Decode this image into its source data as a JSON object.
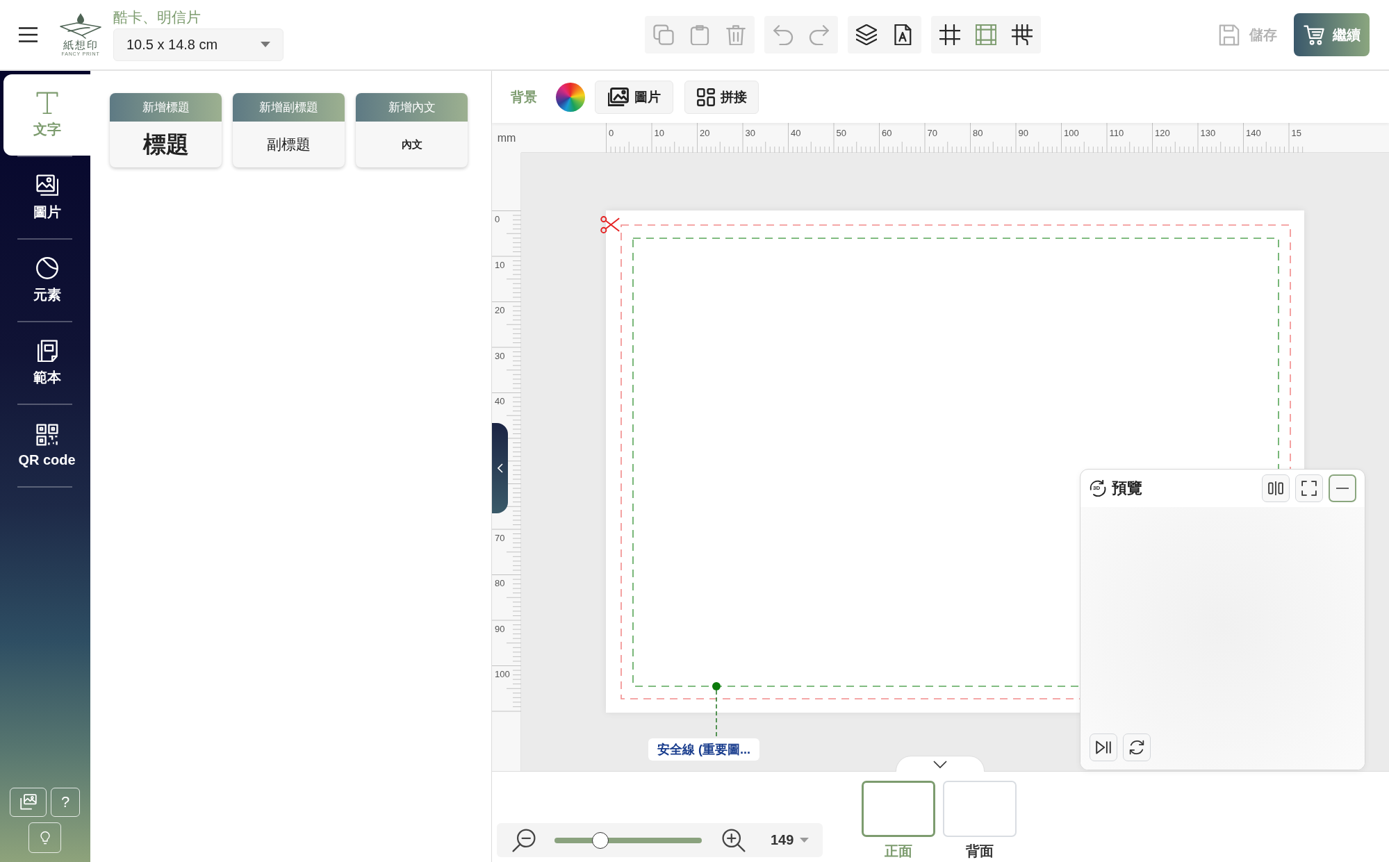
{
  "header": {
    "logo": {
      "name": "紙想印",
      "tagline": "FANCY PRINT"
    },
    "category": "酷卡、明信片",
    "size_select": {
      "value": "10.5 x 14.8 cm"
    },
    "toolbar_groups": [
      {
        "buttons": [
          {
            "disabled": true,
            "on": false
          },
          {
            "disabled": true,
            "on": false
          },
          {
            "disabled": true,
            "on": false
          }
        ]
      },
      {
        "buttons": [
          {
            "disabled": true,
            "on": false
          },
          {
            "disabled": true,
            "on": false
          }
        ]
      },
      {
        "buttons": [
          {
            "disabled": false,
            "on": false
          },
          {
            "disabled": false,
            "on": false
          }
        ]
      },
      {
        "buttons": [
          {
            "disabled": false,
            "on": false
          },
          {
            "disabled": false,
            "on": true
          },
          {
            "disabled": false,
            "on": false
          }
        ]
      }
    ],
    "save": {
      "label": "儲存",
      "disabled": true
    },
    "continue": {
      "label": "繼續"
    }
  },
  "sidebar": {
    "items": [
      {
        "label": "文字",
        "selected": true
      },
      {
        "label": "圖片",
        "selected": false
      },
      {
        "label": "元素",
        "selected": false
      },
      {
        "label": "範本",
        "selected": false
      },
      {
        "label": "QR code",
        "selected": false
      }
    ],
    "help": "?"
  },
  "text_presets": [
    {
      "kind": "title",
      "header": "新增標題",
      "sample": "標題"
    },
    {
      "kind": "subtitle",
      "header": "新增副標題",
      "sample": "副標題"
    },
    {
      "kind": "body",
      "header": "新增內文",
      "sample": "內文"
    }
  ],
  "background_bar": {
    "label": "背景",
    "image_button": "圖片",
    "collage_button": "拼接"
  },
  "ruler": {
    "unit": "mm",
    "top_labels": [
      "0",
      "10",
      "20",
      "30",
      "40",
      "50",
      "60",
      "70",
      "80",
      "90",
      "100",
      "110",
      "120",
      "130",
      "140",
      "15"
    ],
    "left_labels_upper": [
      "0",
      "10",
      "20",
      "30",
      "40"
    ],
    "left_labels_lower": [
      "70",
      "80",
      "90",
      "100"
    ]
  },
  "card": {
    "safety_label": "安全線 (重要圖..."
  },
  "preview": {
    "icon_label": "3D",
    "title": "預覽",
    "buttons": [
      {
        "focused": false
      },
      {
        "focused": false
      },
      {
        "focused": true
      }
    ]
  },
  "zoom": {
    "level": 0.31,
    "value": "149"
  },
  "pages": [
    {
      "label": "正面",
      "selected": true
    },
    {
      "label": "背面",
      "selected": false
    }
  ]
}
